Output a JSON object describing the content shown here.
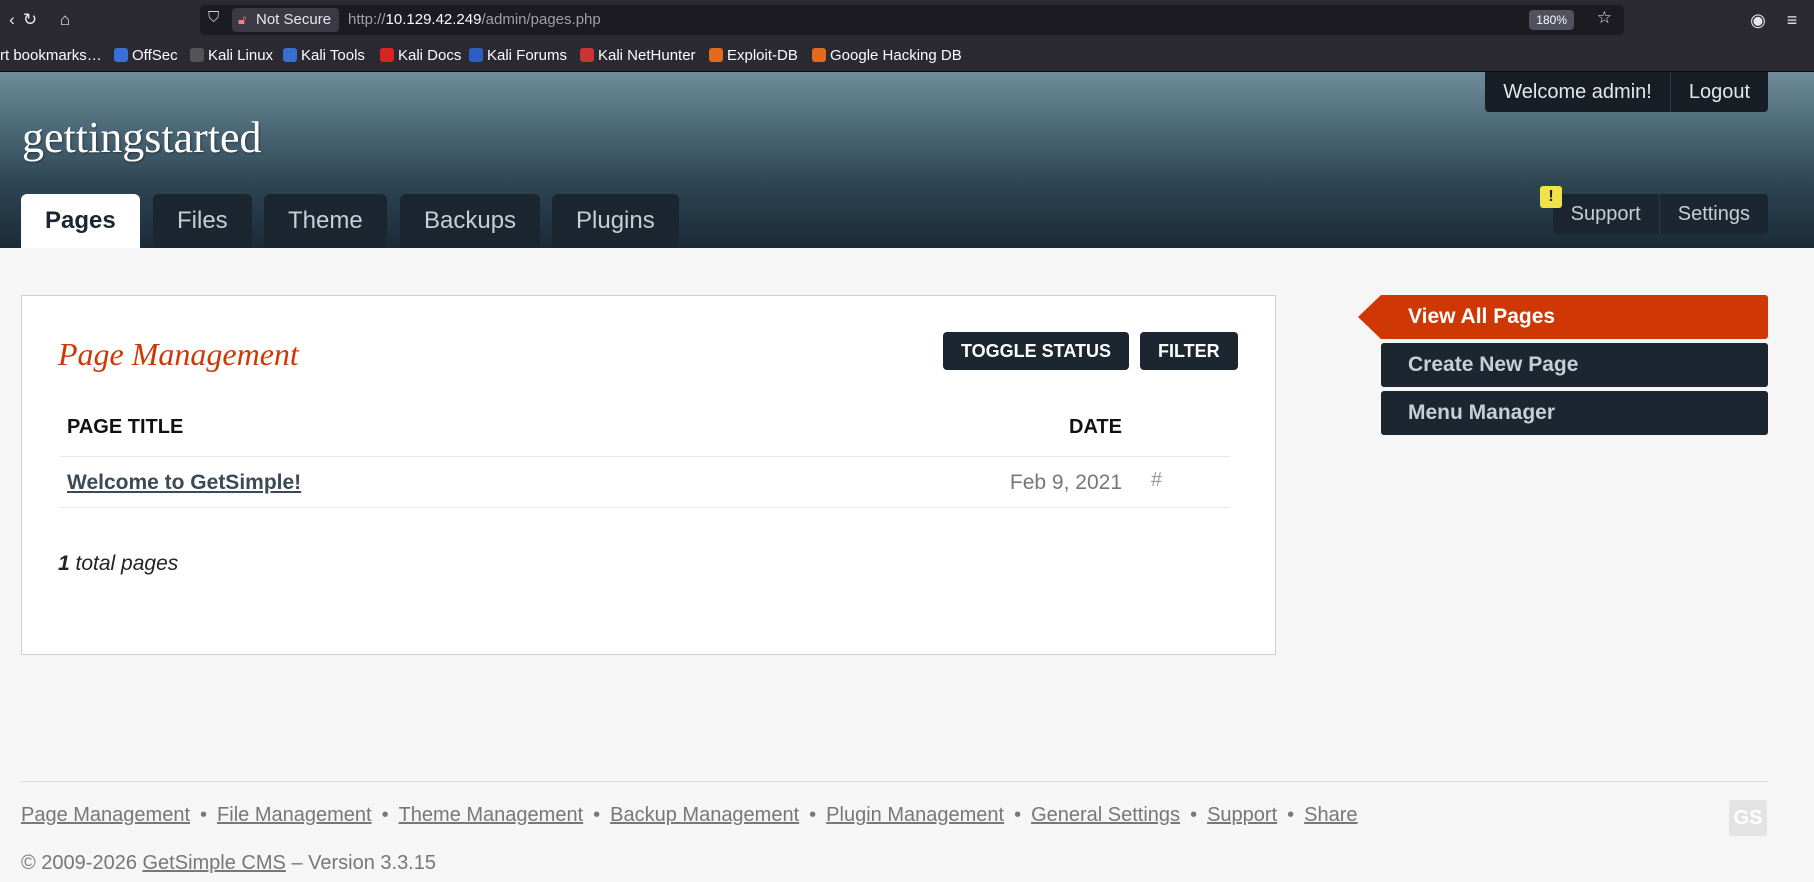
{
  "browser": {
    "security_label": "Not Secure",
    "url_prefix": "http://",
    "url_host": "10.129.42.249",
    "url_path": "/admin/pages.php",
    "zoom": "180%",
    "bookmarks": [
      "rt bookmarks…",
      "OffSec",
      "Kali Linux",
      "Kali Tools",
      "Kali Docs",
      "Kali Forums",
      "Kali NetHunter",
      "Exploit-DB",
      "Google Hacking DB"
    ]
  },
  "header": {
    "site_name": "gettingstarted",
    "welcome": "Welcome admin!",
    "logout": "Logout",
    "tabs": [
      "Pages",
      "Files",
      "Theme",
      "Backups",
      "Plugins"
    ],
    "support": "Support",
    "settings": "Settings",
    "alert": "!"
  },
  "main": {
    "title": "Page Management",
    "toggle_status": "TOGGLE STATUS",
    "filter": "FILTER",
    "col_title": "PAGE TITLE",
    "col_date": "DATE",
    "rows": [
      {
        "title": "Welcome to GetSimple!",
        "date": "Feb 9, 2021",
        "hash": "#"
      }
    ],
    "total_count": "1",
    "total_label": "total pages"
  },
  "sidebar": {
    "items": [
      "View All Pages",
      "Create New Page",
      "Menu Manager"
    ]
  },
  "footer": {
    "links": [
      "Page Management",
      "File Management",
      "Theme Management",
      "Backup Management",
      "Plugin Management",
      "General Settings",
      "Support",
      "Share"
    ],
    "separator": "•",
    "copyright": "© 2009-2026",
    "cms_link": "GetSimple CMS",
    "version": "– Version 3.3.15",
    "logo": "GS"
  }
}
